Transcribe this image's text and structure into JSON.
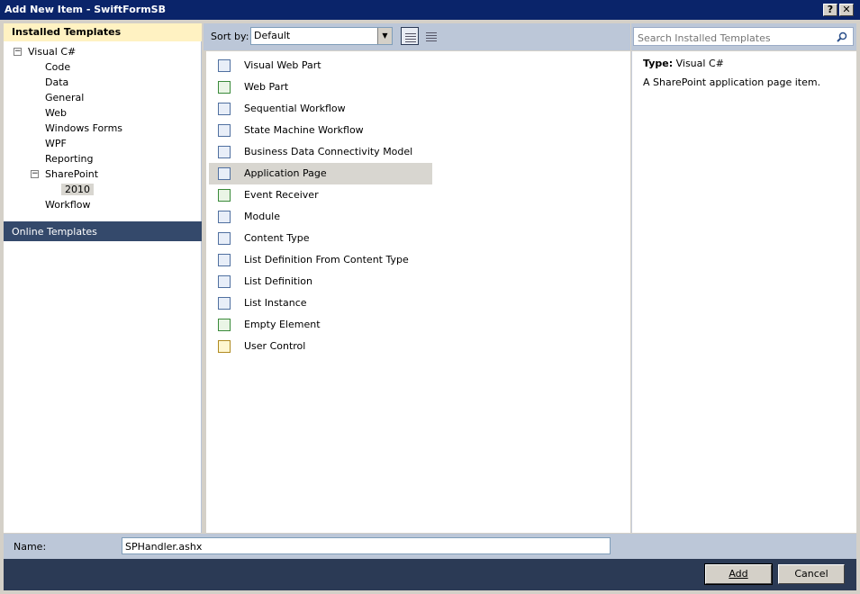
{
  "window": {
    "title": "Add New Item - SwiftFormSB",
    "help_label": "?",
    "close_label": "✕"
  },
  "left": {
    "installed_header": "Installed Templates",
    "tree": [
      {
        "label": "Visual C#",
        "level": 0,
        "expander": "−"
      },
      {
        "label": "Code",
        "level": 1
      },
      {
        "label": "Data",
        "level": 1
      },
      {
        "label": "General",
        "level": 1
      },
      {
        "label": "Web",
        "level": 1
      },
      {
        "label": "Windows Forms",
        "level": 1
      },
      {
        "label": "WPF",
        "level": 1
      },
      {
        "label": "Reporting",
        "level": 1
      },
      {
        "label": "SharePoint",
        "level": 1,
        "expander": "−"
      },
      {
        "label": "2010",
        "level": 2,
        "selected": true
      },
      {
        "label": "Workflow",
        "level": 1
      }
    ],
    "online_templates": "Online Templates"
  },
  "toolbar": {
    "sort_label": "Sort by:",
    "sort_value": "Default"
  },
  "search": {
    "placeholder": "Search Installed Templates"
  },
  "items": [
    {
      "label": "Visual Web Part",
      "icon": "visual-web-part-icon",
      "color": "blue"
    },
    {
      "label": "Web Part",
      "icon": "web-part-icon",
      "color": "green"
    },
    {
      "label": "Sequential Workflow",
      "icon": "workflow-icon",
      "color": "blue"
    },
    {
      "label": "State Machine Workflow",
      "icon": "workflow-icon",
      "color": "blue"
    },
    {
      "label": "Business Data Connectivity Model",
      "icon": "bdc-model-icon",
      "color": "blue"
    },
    {
      "label": "Application Page",
      "icon": "page-icon",
      "color": "blue",
      "selected": true
    },
    {
      "label": "Event Receiver",
      "icon": "event-receiver-icon",
      "color": "green"
    },
    {
      "label": "Module",
      "icon": "module-icon",
      "color": "blue"
    },
    {
      "label": "Content Type",
      "icon": "content-type-icon",
      "color": "blue"
    },
    {
      "label": "List Definition From Content Type",
      "icon": "list-definition-icon",
      "color": "blue"
    },
    {
      "label": "List Definition",
      "icon": "list-definition-icon",
      "color": "blue"
    },
    {
      "label": "List Instance",
      "icon": "list-instance-icon",
      "color": "blue"
    },
    {
      "label": "Empty Element",
      "icon": "empty-element-icon",
      "color": "green"
    },
    {
      "label": "User Control",
      "icon": "user-control-icon",
      "color": "yellow"
    }
  ],
  "details": {
    "type_label": "Type:",
    "type_value": "Visual C#",
    "description": "A SharePoint application page item."
  },
  "bottom": {
    "name_label": "Name:",
    "name_value": "SPHandler.ashx",
    "add_label": "Add",
    "cancel_label": "Cancel"
  }
}
